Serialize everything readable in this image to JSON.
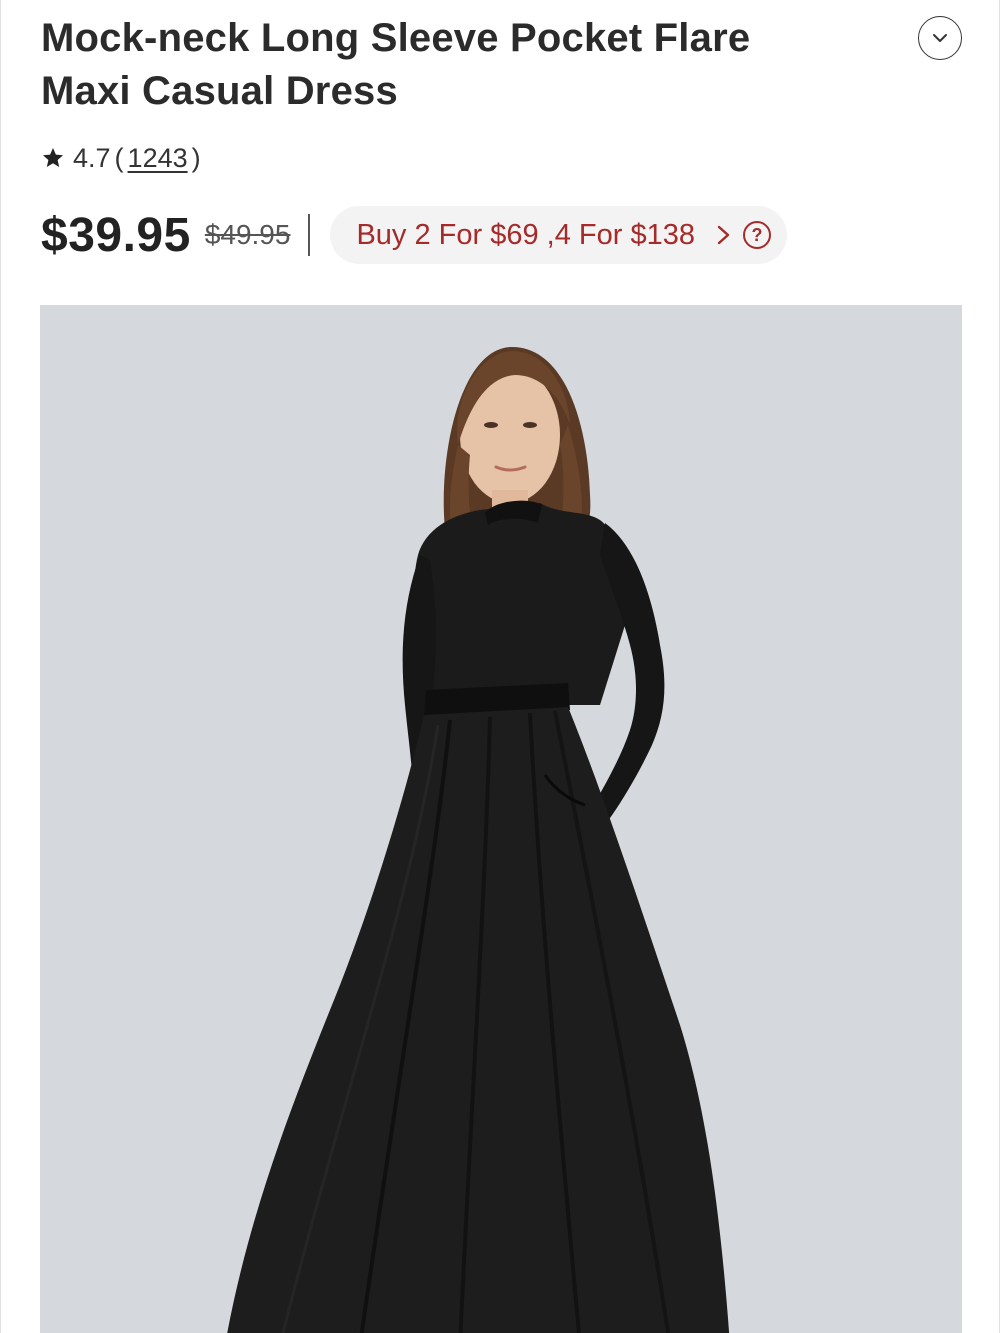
{
  "product": {
    "title": "Mock-neck Long Sleeve Pocket Flare Maxi Casual Dress",
    "rating": "4.7",
    "review_count": "1243",
    "price": "$39.95",
    "original_price": "$49.95",
    "promo_text": "Buy 2 For $69 ,4 For $138",
    "promo_help": "?"
  },
  "icons": {
    "collapse": "chevron-down-icon",
    "star": "star-icon",
    "promo_arrow": "chevron-right-icon",
    "help": "question-circle-icon"
  },
  "colors": {
    "promo_text": "#a52a2a",
    "promo_bg": "#f3f3f3",
    "image_bg": "#d5d8dc",
    "dress": "#1b1b1b"
  }
}
